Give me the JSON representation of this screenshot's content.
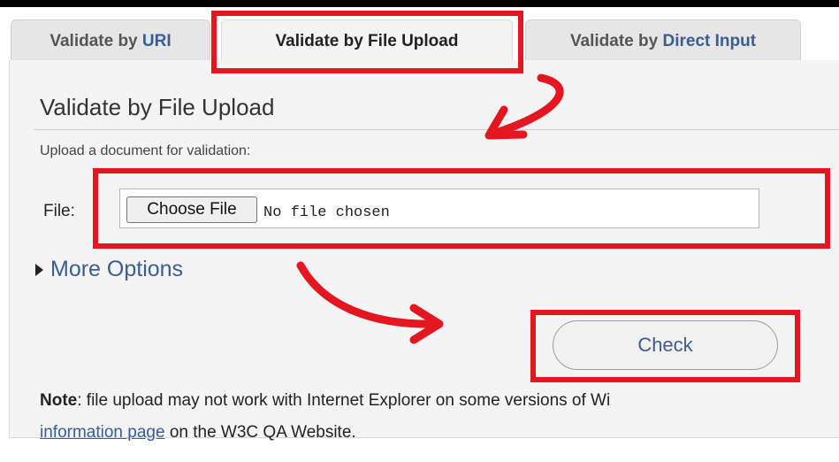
{
  "tabs": [
    {
      "prefix": "Validate by ",
      "highlight": "URI",
      "active": false
    },
    {
      "prefix": "Validate by File Upload",
      "highlight": "",
      "active": true
    },
    {
      "prefix": "Validate by ",
      "highlight": "Direct Input",
      "active": false
    }
  ],
  "section": {
    "legend": "Validate by File Upload",
    "hint": "Upload a document for validation:"
  },
  "file_input": {
    "label": "File:",
    "button_label": "Choose File",
    "status": "No file chosen"
  },
  "more_options": {
    "label": "More Options"
  },
  "check_button": {
    "label": "Check"
  },
  "note": {
    "bold": "Note",
    "text": ": file upload may not work with Internet Explorer on some versions of Wi",
    "link": "information page",
    "after_link": " on the W3C QA Website."
  },
  "colors": {
    "annotation_red": "#e4161f",
    "link_blue": "#3a5d94",
    "panel_bg": "#f4f4f4",
    "tab_bg": "#e6e6e6"
  }
}
